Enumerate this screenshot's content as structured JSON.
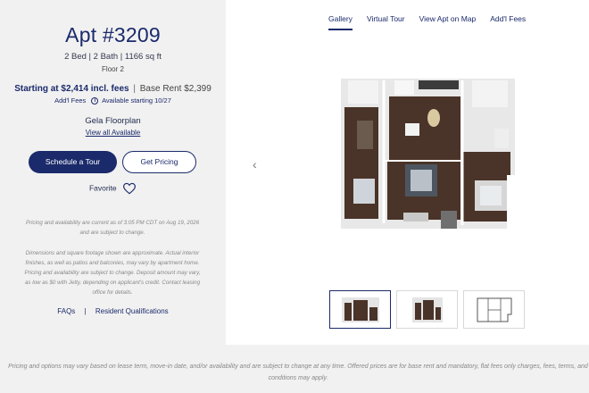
{
  "listing": {
    "title": "Apt #3209",
    "specs": "2 Bed | 2 Bath | 1166 sq ft",
    "floor": "Floor 2",
    "price_starting": "Starting at $2,414 incl. fees",
    "price_separator": "|",
    "base_rent": "Base Rent $2,399",
    "fees_label": "Add'l Fees",
    "info_icon_glyph": "i",
    "availability": "Available starting 10/27",
    "floorplan_name": "Gela Floorplan",
    "view_all_link": "View all Available"
  },
  "actions": {
    "schedule_tour": "Schedule a Tour",
    "get_pricing": "Get Pricing",
    "favorite": "Favorite",
    "favorite_icon": "heart-icon"
  },
  "disclaimers": {
    "pricing_notice": "Pricing and availability are current as of 3:05 PM CDT on Aug 19, 2026 and are subject to change.",
    "dimensions_notice": "Dimensions and square footage shown are approximate. Actual interior finishes, as well as patios and balconies, may vary by apartment home. Pricing and availability are subject to change. Deposit amount may vary, as low as $0 with Jetty, depending on applicant's credit. Contact leasing office for details."
  },
  "links": {
    "faqs": "FAQs",
    "separator": "|",
    "resident_qualifications": "Resident Qualifications"
  },
  "gallery": {
    "tabs": [
      "Gallery",
      "Virtual Tour",
      "View Apt on Map",
      "Add'l Fees"
    ],
    "active_tab": "Gallery",
    "prev_arrow": "‹",
    "thumbnail_count": 3
  },
  "footer": {
    "text": "Pricing and options may vary based on lease term, move-in date, and/or availability and are subject to change at any time. Offered prices are for base rent and mandatory, flat fees only charges, fees, terms, and conditions may apply."
  },
  "colors": {
    "brand": "#1b2a6b",
    "floor_wood": "#4a3328",
    "wall": "#e8e8e8",
    "page_bg": "#f1f1f1"
  }
}
